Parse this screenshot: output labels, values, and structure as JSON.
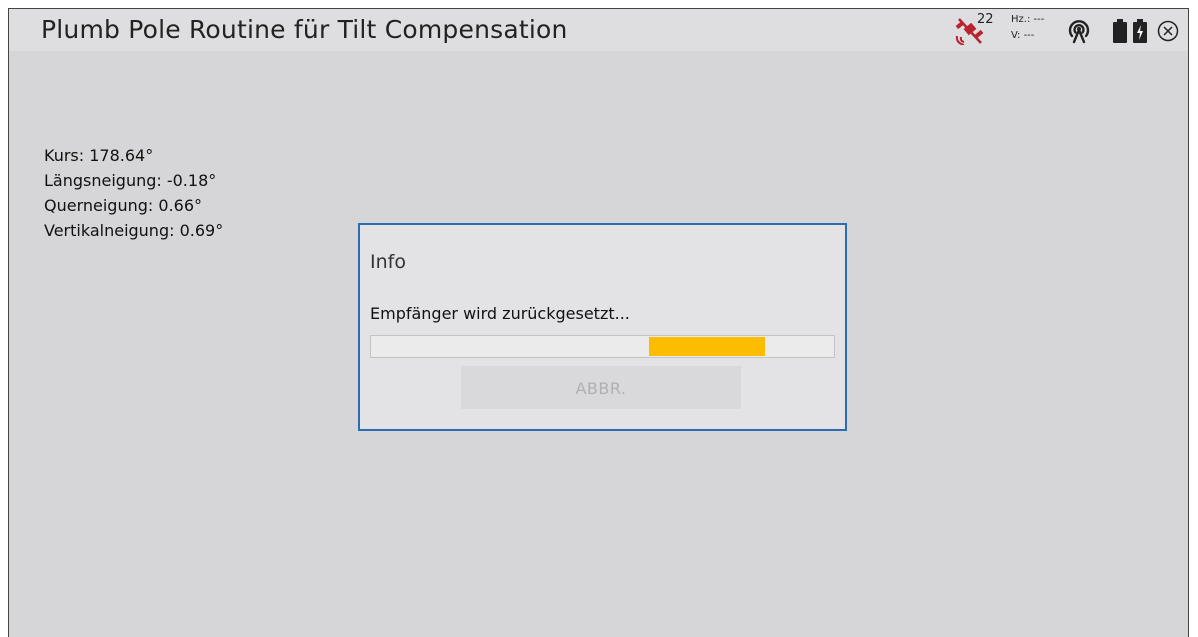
{
  "header": {
    "title": "Plumb Pole Routine für Tilt Compensation",
    "satellite_count": "22",
    "hz_label": "Hz.: ---",
    "v_label": "V: ---",
    "icons": [
      "satellite-off-icon",
      "signal-icon",
      "battery-icon",
      "battery-charging-icon",
      "close-icon"
    ]
  },
  "readouts": {
    "kurs": "Kurs: 178.64°",
    "laengsneigung": "Längsneigung: -0.18°",
    "querneigung": "Querneigung: 0.66°",
    "vertikalneigung": "Vertikalneigung: 0.69°"
  },
  "dialog": {
    "title": "Info",
    "message": "Empfänger wird zurückgesetzt...",
    "progress": {
      "fill_start_fraction": 0.6,
      "fill_end_fraction": 0.85,
      "color": "#fcbc00"
    },
    "cancel_label": "ABBR."
  },
  "colors": {
    "background": "#d6d6d8",
    "dialog_border": "#2b6db0",
    "accent": "#fcbc00",
    "satellite_icon": "#b8232f"
  }
}
